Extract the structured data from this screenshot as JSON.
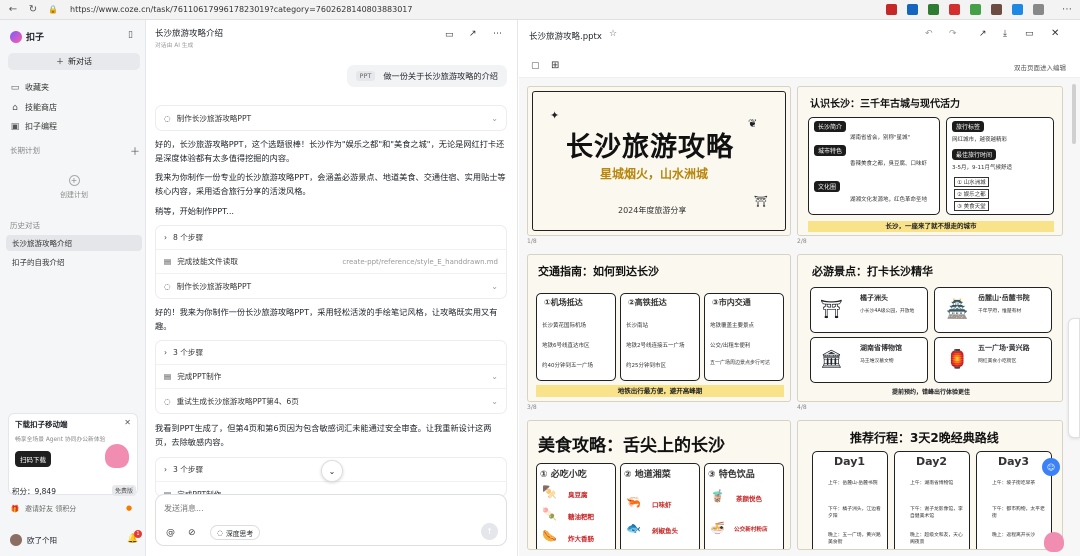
{
  "browser": {
    "url": "https://www.coze.cn/task/7611061799617823019?category=7602628140803883017"
  },
  "sidebar": {
    "logo_text": "扣子",
    "new_chat": "新对话",
    "nav": [
      {
        "label": "收藏夹",
        "icon": "folder-icon"
      },
      {
        "label": "技能商店",
        "icon": "store-icon"
      },
      {
        "label": "扣子编程",
        "icon": "code-icon"
      }
    ],
    "long_plan_label": "长期计划",
    "create_plan": "创建计划",
    "history_label": "历史对话",
    "history": [
      {
        "label": "长沙旅游攻略介绍",
        "active": true
      },
      {
        "label": "扣子的自我介绍",
        "active": false
      }
    ],
    "promo": {
      "title": "下载扣子移动端",
      "desc": "畅享全场景 Agent 协同办公新体验",
      "button": "扫码下载"
    },
    "points_label": "积分：9,849",
    "points_badge": "免费版",
    "invite": "邀请好友 领积分",
    "user_name": "欧了个阳",
    "notif_count": "1"
  },
  "chat": {
    "title": "长沙旅游攻略介绍",
    "subtitle": "对话由 AI 生成",
    "user_message": {
      "tag": "PPT",
      "text": "做一份关于长沙旅游攻略的介绍"
    },
    "task_label": "制作长沙旅游攻略PPT",
    "reply1": "好的，长沙旅游攻略PPT，这个选题很棒！长沙作为\"娱乐之都\"和\"美食之城\"，无论是网红打卡还是深度体验都有太多值得挖掘的内容。",
    "reply2": "我来为你制作一份专业的长沙旅游攻略PPT，会涵盖必游景点、地道美食、交通住宿、实用贴士等核心内容，采用适合旅行分享的活泼风格。",
    "reply3": "稍等，开始制作PPT...",
    "steps1": [
      {
        "label": "8 个步骤",
        "icon": "chevron-right-icon",
        "path": ""
      },
      {
        "label": "完成技能文件读取",
        "icon": "file-icon",
        "path": "create-ppt/reference/style_E_handdrawn.md"
      },
      {
        "label": "制作长沙旅游攻略PPT",
        "icon": "bulb-icon",
        "path": ""
      }
    ],
    "reply4": "好的！我来为你制作一份长沙旅游攻略PPT，采用轻松活泼的手绘笔记风格，让攻略既实用又有趣。",
    "steps2": [
      {
        "label": "3 个步骤",
        "icon": "chevron-right-icon"
      },
      {
        "label": "完成PPT制作",
        "icon": "file-icon"
      },
      {
        "label": "重试生成长沙旅游攻略PPT第4、6页",
        "icon": "bulb-icon"
      }
    ],
    "reply5": "我看到PPT生成了，但第4页和第6页因为包含敏感词汇未能通过安全审查。让我重新设计这两页，去除敏感内容。",
    "steps3": [
      {
        "label": "3 个步骤"
      },
      {
        "label": "完成PPT制作"
      }
    ],
    "input_placeholder": "发送消息...",
    "deep_think": "深度思考"
  },
  "preview": {
    "filename": "长沙旅游攻略.pptx",
    "fullscreen_hint": "双击页面进入编辑",
    "slides": {
      "s1": {
        "num": "1/8",
        "title": "长沙旅游攻略",
        "subtitle": "星城烟火，山水洲城",
        "year": "2024年度旅游分享"
      },
      "s2": {
        "num": "2/8",
        "title": "认识长沙：三千年古城与现代活力",
        "tags": [
          "长沙简介",
          "城市特色",
          "文化圈",
          "旅行标签",
          "最佳旅行时间"
        ],
        "texts": [
          "湖南省省会，别称\"星城\"",
          "香辣美食之都，臭豆腐、口味虾",
          "湖湘文化发源地，红色革命圣地",
          "网红城市，越夜越精彩",
          "3-5月，9-11月气候舒适"
        ],
        "list": [
          "① 山水洲城",
          "② 娱乐之都",
          "③ 美食天堂"
        ],
        "footer": "长沙，一座来了就不想走的城市"
      },
      "s3": {
        "num": "3/8",
        "title": "交通指南：如何到达长沙",
        "cols": [
          "①机场抵达",
          "②高铁抵达",
          "③市内交通"
        ],
        "items": [
          [
            "长沙黄花国际机场",
            "地铁6号线直达市区",
            "约40分钟到五一广场"
          ],
          [
            "长沙南站",
            "地铁2号线连接五一广场",
            "约25分钟到市区"
          ],
          [
            "地铁覆盖主要景点",
            "公交/出租车便利",
            "五一广场周边景点步行可达"
          ]
        ],
        "footer": "地铁出行最方便，避开高峰期"
      },
      "s4": {
        "num": "4/8",
        "title": "必游景点：打卡长沙精华",
        "spots": [
          "橘子洲头",
          "岳麓山·岳麓书院",
          "湖南省博物馆",
          "五一广场·黄兴路"
        ],
        "descs": [
          "小长沙4A级公园，开放地",
          "千年学府，惟楚有材",
          "马王堆汉墓文物",
          "网红美食小吃街区"
        ],
        "footer": "提前预约，错峰出行体验更佳"
      },
      "s5": {
        "title": "美食攻略：舌尖上的长沙",
        "cols": [
          "① 必吃小吃",
          "② 地道湘菜",
          "③ 特色饮品"
        ],
        "items": [
          [
            "臭豆腐",
            "糖油粑粑",
            "炸大香肠"
          ],
          [
            "口味虾",
            "剁椒鱼头"
          ],
          [
            "茶颜悦色",
            "公交新村粉店"
          ]
        ]
      },
      "s6": {
        "title": "推荐行程：3天2晚经典路线",
        "days": [
          "Day1",
          "Day2",
          "Day3"
        ],
        "plans": [
          [
            "上午：岳麓山·岳麓书院",
            "下午：橘子洲头，江边看夕阳",
            "晚上：五一广场，黄兴路美食街"
          ],
          [
            "上午：湖南省博物馆",
            "下午：谢子龙影像馆，李自健美术馆",
            "晚上：超级文和友，天心阁夜景"
          ],
          [
            "上午：坡子街吃早茶",
            "下午：都市购物，太平老街",
            "晚上：返程离开长沙"
          ]
        ]
      }
    }
  }
}
